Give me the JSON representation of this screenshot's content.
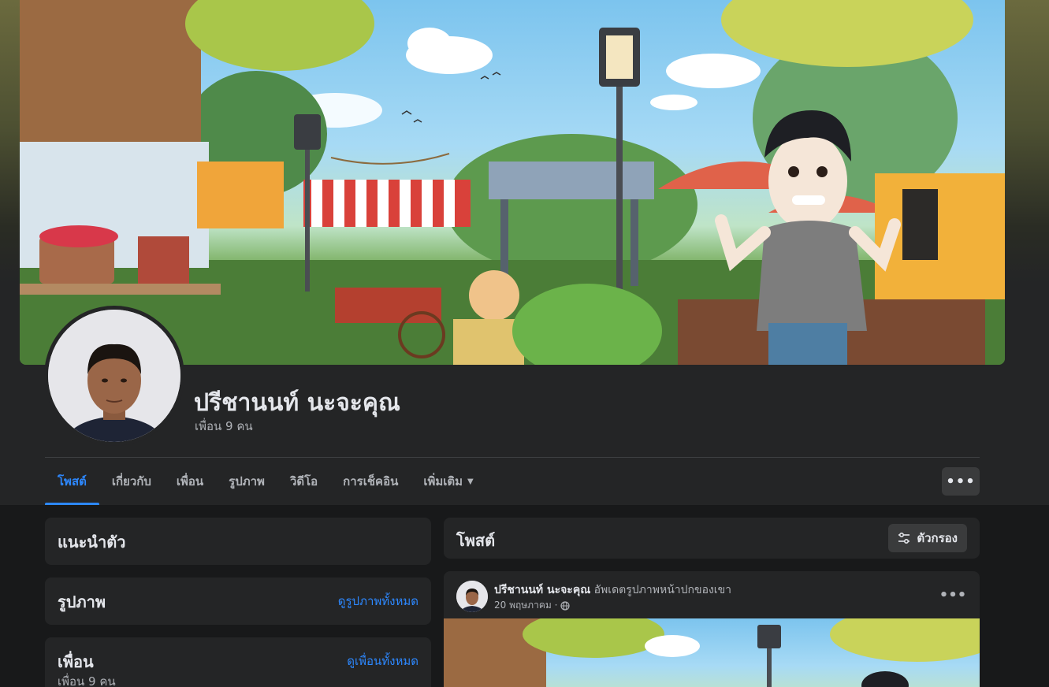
{
  "profile": {
    "name": "ปรีชานนท์ นะจะคุณ",
    "friends": "เพื่อน 9 คน"
  },
  "tabs": [
    {
      "label": "โพสต์",
      "active": true
    },
    {
      "label": "เกี่ยวกับ"
    },
    {
      "label": "เพื่อน"
    },
    {
      "label": "รูปภาพ"
    },
    {
      "label": "วิดีโอ"
    },
    {
      "label": "การเช็คอิน"
    },
    {
      "label": "เพิ่มเติม"
    }
  ],
  "intro": {
    "title": "แนะนำตัว"
  },
  "photos": {
    "title": "รูปภาพ",
    "link": "ดูรูปภาพทั้งหมด"
  },
  "friends_card": {
    "title": "เพื่อน",
    "link": "ดูเพื่อนทั้งหมด",
    "count": "เพื่อน 9 คน"
  },
  "posts_card": {
    "title": "โพสต์",
    "filter_label": "ตัวกรอง"
  },
  "post": {
    "author": "ปรีชานนท์ นะจะคุณ",
    "action": "อัพเดตรูปภาพหน้าปกของเขา",
    "date": "20 พฤษภาคม ·"
  },
  "colors": {
    "accent": "#2d88ff",
    "surface": "#242526",
    "background": "#18191a"
  },
  "icons": [
    "globe-icon",
    "filter-icon",
    "more-icon",
    "chevron-down-icon"
  ]
}
